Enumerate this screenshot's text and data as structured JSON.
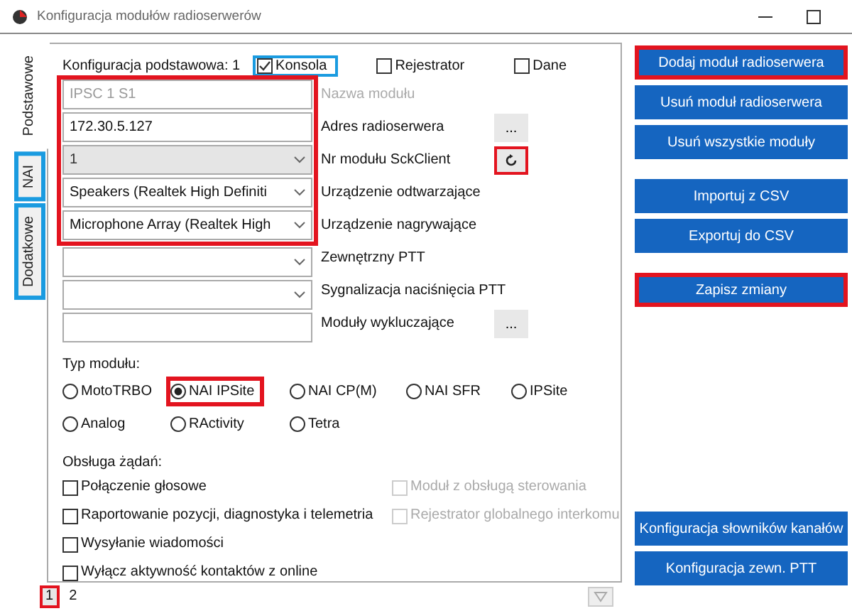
{
  "window": {
    "title": "Konfiguracja modułów radioserwerów"
  },
  "side_tabs": [
    {
      "label": "Podstawowe",
      "selected": true,
      "highlighted": false
    },
    {
      "label": "NAI",
      "selected": false,
      "highlighted": true,
      "color": "#1a9be0"
    },
    {
      "label": "Dodatkowe",
      "selected": false,
      "highlighted": true,
      "color": "#1a9be0"
    }
  ],
  "panel": {
    "heading": "Konfiguracja podstawowa: 1",
    "roles": [
      {
        "label": "Konsola",
        "checked": true,
        "highlighted": true,
        "color": "#1a9be0"
      },
      {
        "label": "Rejestrator",
        "checked": false,
        "highlighted": false
      },
      {
        "label": "Dane",
        "checked": false,
        "highlighted": false
      }
    ],
    "field_group": {
      "highlighted": true,
      "color": "#e3141f"
    },
    "highlighted_fields": [
      {
        "kind": "text",
        "value": "IPSC 1 S1",
        "disabled": true,
        "label": "Nazwa modułu"
      },
      {
        "kind": "text",
        "value": "172.30.5.127",
        "disabled": false,
        "label": "Adres radioserwera",
        "action": {
          "kind": "dots",
          "label": "...",
          "highlighted": false
        }
      },
      {
        "kind": "combo",
        "value": "1",
        "disabled": true,
        "label": "Nr modułu SckClient",
        "action": {
          "kind": "refresh",
          "highlighted": true,
          "color": "#e3141f"
        }
      },
      {
        "kind": "combo",
        "value": "Speakers (Realtek High Definiti",
        "disabled": false,
        "label": "Urządzenie odtwarzające"
      },
      {
        "kind": "combo",
        "value": "Microphone Array (Realtek High",
        "disabled": false,
        "label": "Urządzenie nagrywające"
      }
    ],
    "other_fields": [
      {
        "kind": "combo",
        "label": "Zewnętrzny PTT"
      },
      {
        "kind": "combo",
        "label": "Sygnalizacja naciśnięcia PTT"
      },
      {
        "kind": "text",
        "label": "Moduły wykluczające",
        "action": {
          "kind": "dots",
          "label": "...",
          "highlighted": false
        }
      }
    ],
    "module_type_label": "Typ modułu:",
    "module_types": [
      {
        "label": "MotoTRBO",
        "selected": false,
        "highlighted": false
      },
      {
        "label": "NAI IPSite",
        "selected": true,
        "highlighted": true,
        "color": "#e3141f"
      },
      {
        "label": "NAI CP(M)",
        "selected": false,
        "highlighted": false
      },
      {
        "label": "NAI SFR",
        "selected": false,
        "highlighted": false
      },
      {
        "label": "IPSite",
        "selected": false,
        "highlighted": false
      },
      {
        "label": "Analog",
        "selected": false,
        "highlighted": false
      },
      {
        "label": "RActivity",
        "selected": false,
        "highlighted": false
      },
      {
        "label": "Tetra",
        "selected": false,
        "highlighted": false
      }
    ],
    "requests_label": "Obsługa żądań:",
    "requests": [
      {
        "label": "Połączenie głosowe",
        "checked": false,
        "disabled": false
      },
      {
        "label": "Moduł z obsługą sterowania",
        "checked": false,
        "disabled": true
      },
      {
        "label": "Raportowanie pozycji, diagnostyka i telemetria",
        "checked": false,
        "disabled": false
      },
      {
        "label": "Rejestrator globalnego interkomu",
        "checked": false,
        "disabled": true
      },
      {
        "label": "Wysyłanie wiadomości",
        "checked": false,
        "disabled": false
      },
      {
        "label": "Wyłącz aktywność kontaktów z online",
        "checked": false,
        "disabled": false
      }
    ]
  },
  "pages": [
    {
      "label": "1",
      "selected": true,
      "highlighted": true,
      "color": "#e3141f"
    },
    {
      "label": "2",
      "selected": false,
      "highlighted": false
    }
  ],
  "button_groups": [
    [
      {
        "label": "Dodaj moduł radioserwera",
        "highlighted": true,
        "color": "#e3141f"
      },
      {
        "label": "Usuń moduł radioserwera",
        "highlighted": false
      },
      {
        "label": "Usuń wszystkie moduły",
        "highlighted": false
      }
    ],
    [
      {
        "label": "Importuj z CSV",
        "highlighted": false
      },
      {
        "label": "Exportuj do CSV",
        "highlighted": false
      }
    ],
    [
      {
        "label": "Zapisz zmiany",
        "highlighted": true,
        "color": "#e3141f"
      }
    ]
  ],
  "bottom_buttons": [
    {
      "label": "Konfiguracja słowników kanałów",
      "highlighted": false
    },
    {
      "label": "Konfiguracja zewn. PTT",
      "highlighted": false
    }
  ]
}
